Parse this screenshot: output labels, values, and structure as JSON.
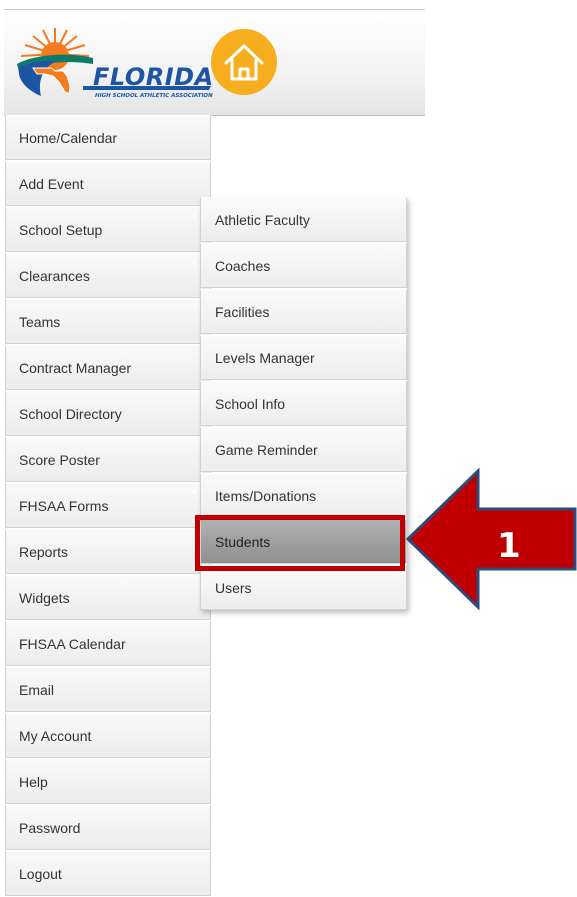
{
  "header": {
    "logo_text": "FLORIDA",
    "logo_subtext": "HIGH SCHOOL ATHLETIC ASSOCIATION",
    "home_icon": "home-icon"
  },
  "menu": {
    "items": [
      {
        "label": "Home/Calendar",
        "has_submenu": false
      },
      {
        "label": "Add Event",
        "has_submenu": false
      },
      {
        "label": "School Setup",
        "has_submenu": true
      },
      {
        "label": "Clearances",
        "has_submenu": true
      },
      {
        "label": "Teams",
        "has_submenu": false
      },
      {
        "label": "Contract Manager",
        "has_submenu": false
      },
      {
        "label": "School Directory",
        "has_submenu": false
      },
      {
        "label": "Score Poster",
        "has_submenu": false
      },
      {
        "label": "FHSAA Forms",
        "has_submenu": true
      },
      {
        "label": "Reports",
        "has_submenu": false
      },
      {
        "label": "Widgets",
        "has_submenu": false
      },
      {
        "label": "FHSAA Calendar",
        "has_submenu": false
      },
      {
        "label": "Email",
        "has_submenu": false
      },
      {
        "label": "My Account",
        "has_submenu": false
      },
      {
        "label": "Help",
        "has_submenu": false
      },
      {
        "label": "Password",
        "has_submenu": false
      },
      {
        "label": "Logout",
        "has_submenu": false
      }
    ]
  },
  "submenu": {
    "parent": "School Setup",
    "items": [
      {
        "label": "Athletic Faculty"
      },
      {
        "label": "Coaches"
      },
      {
        "label": "Facilities"
      },
      {
        "label": "Levels Manager"
      },
      {
        "label": "School Info"
      },
      {
        "label": "Game Reminder"
      },
      {
        "label": "Items/Donations"
      },
      {
        "label": "Students",
        "active": true
      },
      {
        "label": "Users"
      }
    ]
  },
  "callout": {
    "step_number": "1",
    "color": "#c00000"
  },
  "colors": {
    "logo_blue": "#1d55a5",
    "logo_orange": "#f47c20",
    "logo_green": "#0f7a6a",
    "home_button": "#f7ae1e"
  }
}
